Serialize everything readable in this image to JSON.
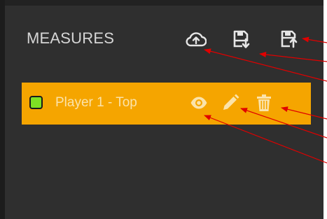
{
  "panel": {
    "title": "MEASURES",
    "toolbar": {
      "upload_icon": "cloud-upload-icon",
      "save_icon": "save-download-icon",
      "save_upload_icon": "save-upload-icon"
    }
  },
  "measures": [
    {
      "label": "Player 1 - Top",
      "color": "#7ee024",
      "actions": [
        "eye-icon",
        "pencil-icon",
        "trash-icon"
      ]
    }
  ],
  "colors": {
    "panel_bg": "#2f2f2f",
    "row_highlight": "#f5a500",
    "annotation_arrow": "#e00000"
  }
}
